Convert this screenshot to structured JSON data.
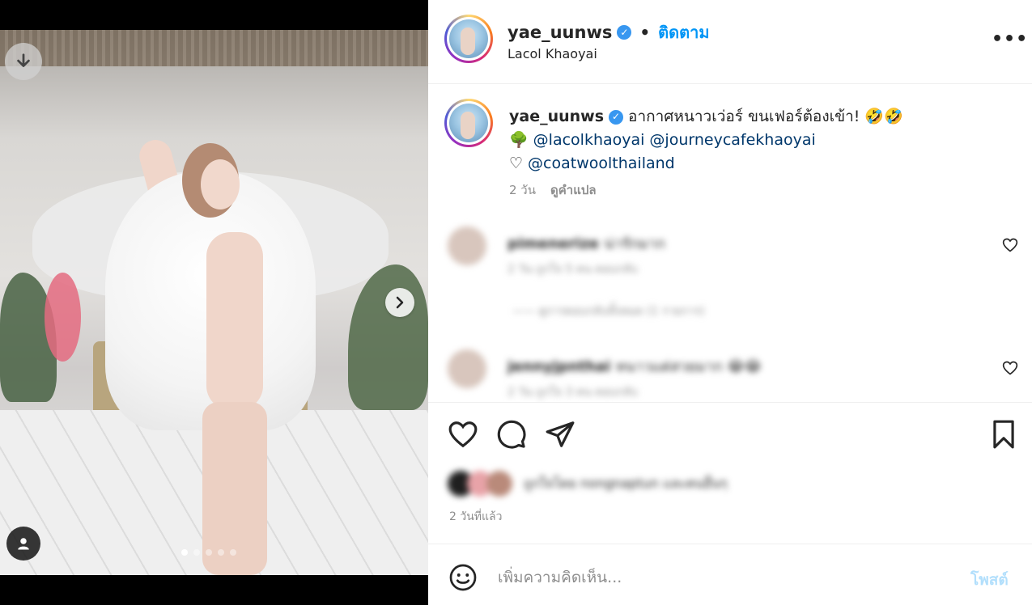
{
  "post": {
    "username": "yae_uunws",
    "follow_label": "ติดตาม",
    "separator": "•",
    "location": "Lacol Khaoyai",
    "more_label": "•••"
  },
  "caption": {
    "username": "yae_uunws",
    "text": "อากาศหนาวเว่อร์ ขนเฟอร์ต้องเข้า! 🤣🤣",
    "tree_emoji": "🌳",
    "mention_1": "@lacolkhaoyai",
    "mention_2": "@journeycafekhaoyai",
    "heart_emoji": "♡",
    "mention_3": "@coatwoolthailand",
    "time": "2 วัน",
    "translate_label": "ดูคำแปล"
  },
  "comments": [
    {
      "user": "pimenerize",
      "text": "น่ารักมาก",
      "meta": "2 วัน   ถูกใจ 5 คน   ตอบกลับ",
      "replies": "—— ดูการตอบกลับทั้งหมด (1 รายการ)"
    },
    {
      "user": "jennyjpnthai",
      "text": "หนาวแต่สวยมาก 😂😂",
      "meta": "2 วัน   ถูกใจ 3 คน   ตอบกลับ",
      "replies": ""
    }
  ],
  "likes_text": "ถูกใจโดย nongnaptun และคนอื่นๆ",
  "time_ago": "2 วันที่แล้ว",
  "comment_input": {
    "placeholder": "เพิ่มความคิดเห็น..."
  },
  "post_button": "โพสต์",
  "carousel": {
    "slide_count": 5,
    "active_slide": 1
  },
  "icons": {
    "download": "download-icon",
    "next": "chevron-right-icon",
    "tag": "user-tag-icon",
    "like": "heart-icon",
    "comment": "comment-bubble-icon",
    "share": "paper-plane-icon",
    "save": "bookmark-icon",
    "emoji": "emoji-smile-icon"
  },
  "colors": {
    "accent": "#0095f6",
    "verified": "#3897f0",
    "mention": "#00376b",
    "post_disabled": "#b2dffc"
  }
}
